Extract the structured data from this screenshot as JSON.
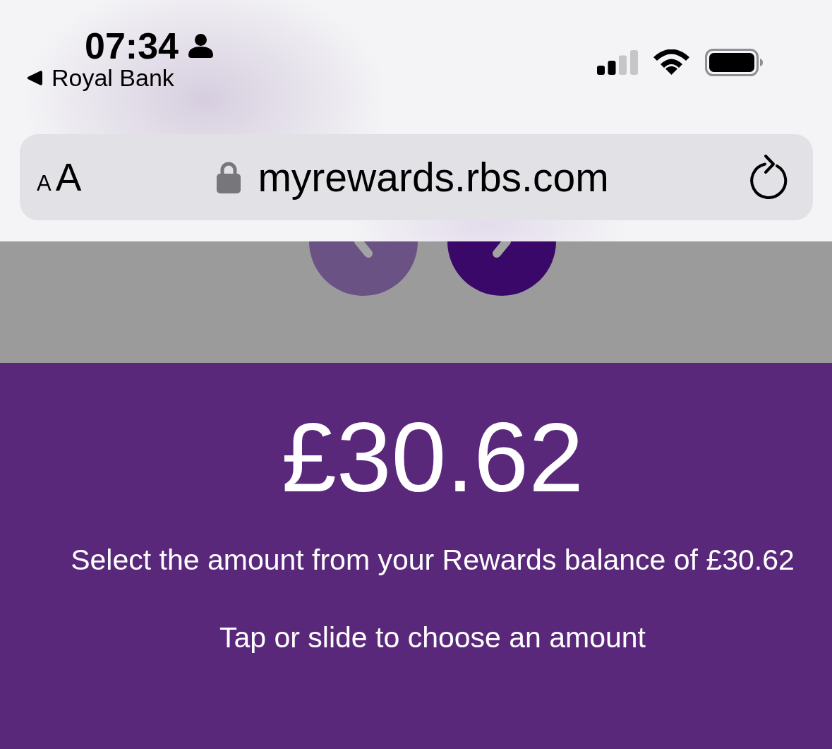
{
  "status_bar": {
    "time": "07:34",
    "back_label": "Royal Bank"
  },
  "address_bar": {
    "text_size_small": "A",
    "text_size_large": "A",
    "url": "myrewards.rbs.com"
  },
  "nav_buttons": [
    {
      "kind": "previous",
      "disabled": true
    },
    {
      "kind": "next",
      "disabled": false
    }
  ],
  "balance": {
    "amount": "£30.62",
    "description": "Select the amount from your Rewards balance of £30.62",
    "hint": "Tap or slide to choose an amount"
  }
}
